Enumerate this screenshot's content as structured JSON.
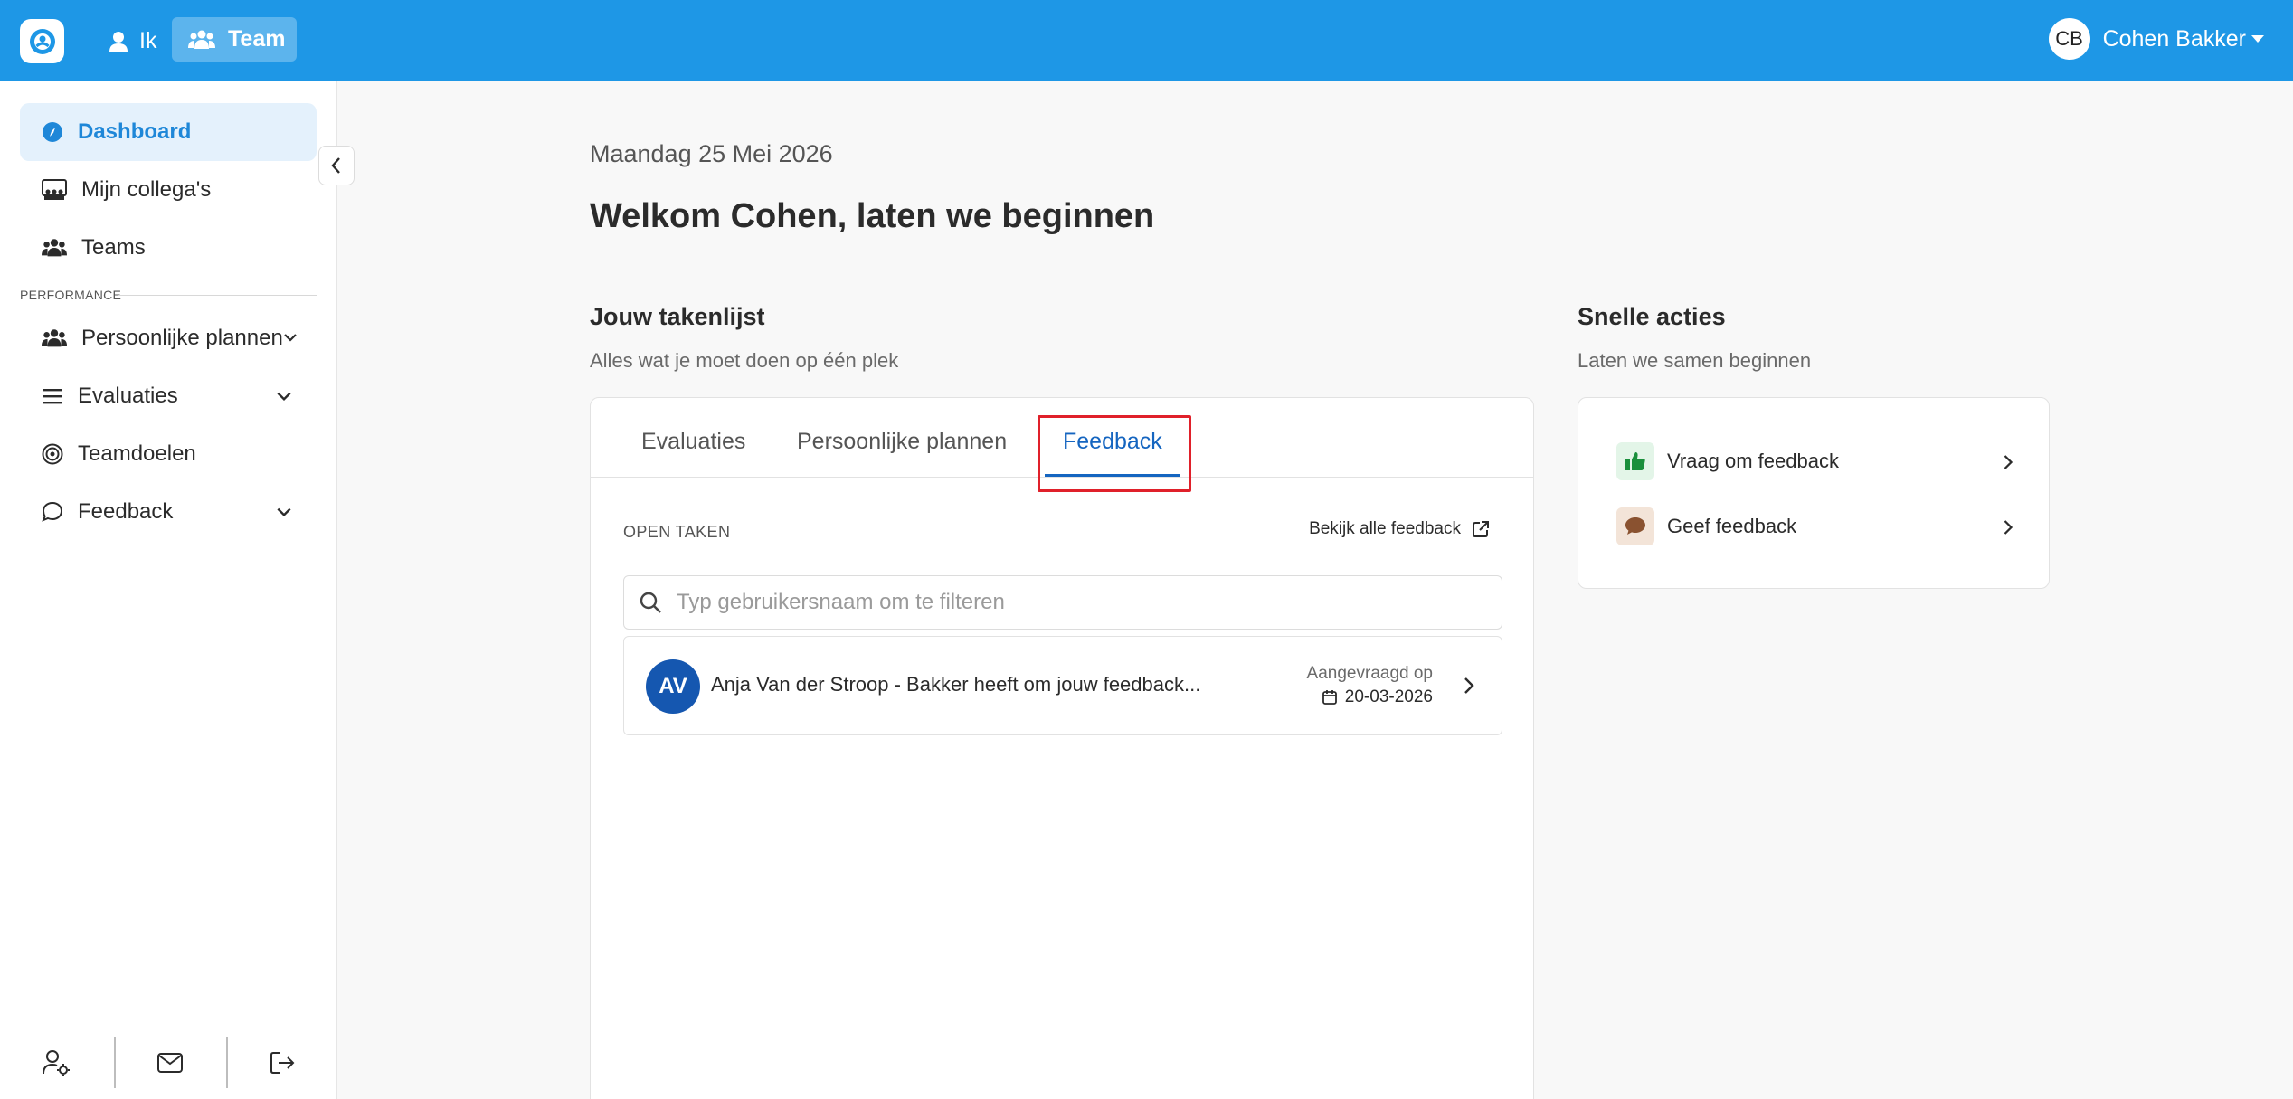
{
  "topbar": {
    "nav_ik": "Ik",
    "nav_team": "Team",
    "user_initials": "CB",
    "user_name": "Cohen Bakker"
  },
  "sidebar": {
    "items": [
      {
        "label": "Dashboard",
        "icon": "compass-icon"
      },
      {
        "label": "Mijn collega's",
        "icon": "colleagues-icon"
      },
      {
        "label": "Teams",
        "icon": "users-icon"
      },
      {
        "label": "Persoonlijke plannen",
        "icon": "users-icon"
      },
      {
        "label": "Evaluaties",
        "icon": "list-icon"
      },
      {
        "label": "Teamdoelen",
        "icon": "target-icon"
      },
      {
        "label": "Feedback",
        "icon": "speech-bubble-icon"
      }
    ],
    "section_label": "PERFORMANCE"
  },
  "main": {
    "date": "Maandag 25 Mei 2026",
    "welcome": "Welkom Cohen, laten we beginnen"
  },
  "tasks": {
    "title": "Jouw takenlijst",
    "subtitle": "Alles wat je moet doen op één plek",
    "tabs": [
      "Evaluaties",
      "Persoonlijke plannen",
      "Feedback"
    ],
    "active_tab": "Feedback",
    "open_label": "OPEN TAKEN",
    "view_all": "Bekijk alle feedback",
    "search_placeholder": "Typ gebruikersnaam om te filteren",
    "rows": [
      {
        "initials": "AV",
        "text": "Anja Van der Stroop - Bakker heeft om jouw feedback...",
        "meta_label": "Aangevraagd op",
        "date": "20-03-2026"
      }
    ]
  },
  "quick": {
    "title": "Snelle acties",
    "subtitle": "Laten we samen beginnen",
    "items": [
      {
        "label": "Vraag om feedback",
        "icon": "thumbs-up-icon",
        "color": "#1a8f3c",
        "bg": "#e3f5e8"
      },
      {
        "label": "Geef feedback",
        "icon": "chat-bubble-icon",
        "color": "#8a5230",
        "bg": "#f3e4d8"
      }
    ]
  },
  "colors": {
    "brand": "#1e97e6",
    "active_tab": "#1565c0",
    "highlight": "#e0202a"
  }
}
